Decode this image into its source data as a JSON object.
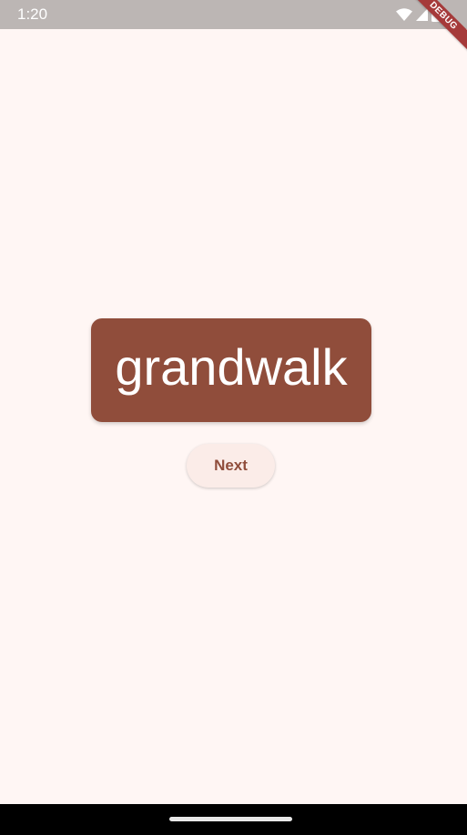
{
  "status_bar": {
    "time": "1:20",
    "icons": [
      "wifi-icon",
      "cellular-signal-icon",
      "battery-icon"
    ]
  },
  "debug_banner": {
    "label": "DEBUG"
  },
  "main": {
    "word": "grandwalk",
    "next_label": "Next"
  },
  "colors": {
    "background": "#fff6f4",
    "card": "#904d3b",
    "button_bg": "#fbece8",
    "button_text": "#904d3b",
    "status_bar": "#bcb6b4",
    "debug_banner": "#a53a3a"
  }
}
